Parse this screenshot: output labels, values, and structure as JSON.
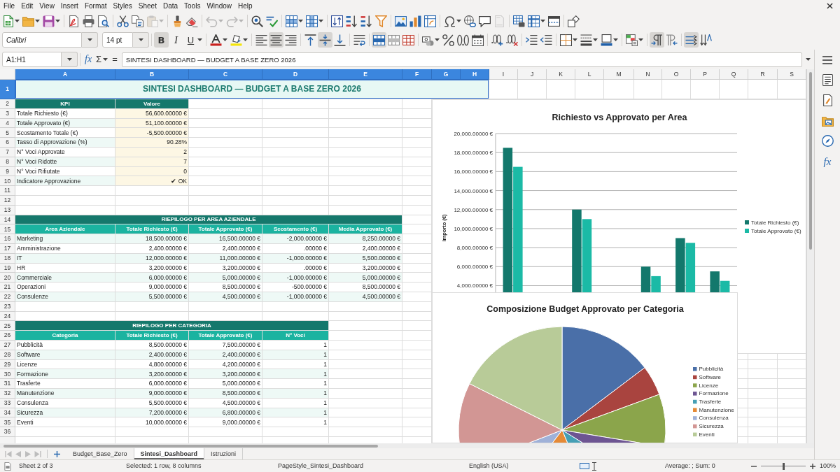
{
  "menu": [
    "File",
    "Edit",
    "View",
    "Insert",
    "Format",
    "Styles",
    "Sheet",
    "Data",
    "Tools",
    "Window",
    "Help"
  ],
  "standard_toolbar": [
    [
      {
        "kind": "new",
        "disabled": false
      },
      {
        "kind": "open",
        "disabled": false
      },
      {
        "kind": "save",
        "disabled": false
      }
    ],
    [
      {
        "kind": "pdf",
        "disabled": false
      },
      {
        "kind": "print",
        "disabled": false
      },
      {
        "kind": "preview",
        "disabled": false
      }
    ],
    [
      {
        "kind": "cut",
        "disabled": false
      },
      {
        "kind": "copy",
        "disabled": false
      },
      {
        "kind": "paste",
        "disabled": true
      }
    ],
    [
      {
        "kind": "clone",
        "disabled": false
      },
      {
        "kind": "clear",
        "disabled": false
      }
    ],
    [
      {
        "kind": "undo",
        "disabled": true
      },
      {
        "kind": "redo",
        "disabled": true
      }
    ],
    [
      {
        "kind": "find",
        "disabled": false
      },
      {
        "kind": "spelling",
        "disabled": false
      }
    ],
    [
      {
        "kind": "row",
        "disabled": false
      },
      {
        "kind": "column",
        "disabled": false
      }
    ],
    [
      {
        "kind": "sort",
        "disabled": false
      },
      {
        "kind": "ascending",
        "disabled": false
      },
      {
        "kind": "descending",
        "disabled": false
      },
      {
        "kind": "filter",
        "disabled": false
      }
    ],
    [
      {
        "kind": "image",
        "disabled": false
      },
      {
        "kind": "chart",
        "disabled": false
      },
      {
        "kind": "pivot",
        "disabled": false
      }
    ],
    [
      {
        "kind": "symbol",
        "disabled": false
      },
      {
        "kind": "hyperlink",
        "disabled": false
      },
      {
        "kind": "comment",
        "disabled": false
      },
      {
        "kind": "headerfooter",
        "disabled": true
      }
    ],
    [
      {
        "kind": "printarea",
        "disabled": false
      },
      {
        "kind": "freeze",
        "disabled": false
      },
      {
        "kind": "split",
        "disabled": false
      }
    ],
    [
      {
        "kind": "shapes",
        "disabled": false
      }
    ]
  ],
  "formatting_toolbar": {
    "font_name": "Calibri",
    "font_size": "14 pt",
    "groups": [
      [
        {
          "kind": "bold",
          "label": "B",
          "on": true
        },
        {
          "kind": "italic",
          "label": "I",
          "on": false
        },
        {
          "kind": "underline",
          "label": "U",
          "on": false
        }
      ],
      [
        {
          "kind": "fontcolor",
          "on": false
        },
        {
          "kind": "highlight",
          "on": false
        }
      ],
      [
        {
          "kind": "alignleft",
          "on": false
        },
        {
          "kind": "aligncenter",
          "on": true
        },
        {
          "kind": "alignright",
          "on": false
        }
      ],
      [
        {
          "kind": "aligntop",
          "on": false
        },
        {
          "kind": "alignmiddle",
          "on": true
        },
        {
          "kind": "alignbottom",
          "on": false
        }
      ],
      [
        {
          "kind": "wrap",
          "on": false
        }
      ],
      [
        {
          "kind": "mergecenter",
          "on": true
        },
        {
          "kind": "merge",
          "on": false
        },
        {
          "kind": "unmerge",
          "on": false
        }
      ],
      [
        {
          "kind": "currency",
          "on": false
        },
        {
          "kind": "percent",
          "on": false
        },
        {
          "kind": "number",
          "on": false
        },
        {
          "kind": "date",
          "on": false
        }
      ],
      [
        {
          "kind": "adddecimal",
          "on": false
        },
        {
          "kind": "deletedecimal",
          "on": false
        }
      ],
      [
        {
          "kind": "indent",
          "on": false
        },
        {
          "kind": "outdent",
          "on": false
        }
      ],
      [
        {
          "kind": "borders",
          "on": false
        },
        {
          "kind": "borderstyle",
          "on": false
        },
        {
          "kind": "bordercolor",
          "on": false
        }
      ],
      [
        {
          "kind": "conditional",
          "on": false
        }
      ],
      [
        {
          "kind": "ltr",
          "on": true
        },
        {
          "kind": "rtl",
          "on": false
        }
      ],
      [
        {
          "kind": "horizontal",
          "on": true
        },
        {
          "kind": "vertical",
          "on": false
        }
      ]
    ]
  },
  "formula_bar": {
    "name_box": "A1:H1",
    "wizard": "fx",
    "sum": "Σ",
    "equals": "=",
    "formula": "SINTESI DASHBOARD — BUDGET A BASE ZERO 2026"
  },
  "sidebar": {
    "functions_tab": "fx"
  },
  "sheet": {
    "columns": [
      {
        "label": "A",
        "selected": true
      },
      {
        "label": "B",
        "selected": true
      },
      {
        "label": "C",
        "selected": true
      },
      {
        "label": "D",
        "selected": true
      },
      {
        "label": "E",
        "selected": true
      },
      {
        "label": "F",
        "selected": true
      },
      {
        "label": "G",
        "selected": true
      },
      {
        "label": "H",
        "selected": true
      },
      {
        "label": "I",
        "selected": false
      },
      {
        "label": "J",
        "selected": false
      },
      {
        "label": "K",
        "selected": false
      },
      {
        "label": "L",
        "selected": false
      },
      {
        "label": "M",
        "selected": false
      },
      {
        "label": "N",
        "selected": false
      },
      {
        "label": "O",
        "selected": false
      },
      {
        "label": "P",
        "selected": false
      },
      {
        "label": "Q",
        "selected": false
      },
      {
        "label": "R",
        "selected": false
      },
      {
        "label": "S",
        "selected": false
      }
    ],
    "rows": [
      {
        "label": "1",
        "selected": true
      },
      {
        "label": "2",
        "selected": false
      },
      {
        "label": "3",
        "selected": false
      },
      {
        "label": "4",
        "selected": false
      },
      {
        "label": "5",
        "selected": false
      },
      {
        "label": "6",
        "selected": false
      },
      {
        "label": "7",
        "selected": false
      },
      {
        "label": "8",
        "selected": false
      },
      {
        "label": "9",
        "selected": false
      },
      {
        "label": "10",
        "selected": false
      },
      {
        "label": "11",
        "selected": false
      },
      {
        "label": "12",
        "selected": false
      },
      {
        "label": "13",
        "selected": false
      },
      {
        "label": "14",
        "selected": false
      },
      {
        "label": "15",
        "selected": false
      },
      {
        "label": "16",
        "selected": false
      },
      {
        "label": "17",
        "selected": false
      },
      {
        "label": "18",
        "selected": false
      },
      {
        "label": "19",
        "selected": false
      },
      {
        "label": "20",
        "selected": false
      },
      {
        "label": "21",
        "selected": false
      },
      {
        "label": "22",
        "selected": false
      },
      {
        "label": "23",
        "selected": false
      },
      {
        "label": "24",
        "selected": false
      },
      {
        "label": "25",
        "selected": false
      },
      {
        "label": "26",
        "selected": false
      },
      {
        "label": "27",
        "selected": false
      },
      {
        "label": "28",
        "selected": false
      },
      {
        "label": "29",
        "selected": false
      },
      {
        "label": "30",
        "selected": false
      },
      {
        "label": "31",
        "selected": false
      },
      {
        "label": "32",
        "selected": false
      },
      {
        "label": "33",
        "selected": false
      },
      {
        "label": "34",
        "selected": false
      },
      {
        "label": "35",
        "selected": false
      },
      {
        "label": "36",
        "selected": false
      }
    ],
    "title": "SINTESI DASHBOARD — BUDGET A BASE ZERO 2026",
    "kpi_table": {
      "columns": [
        "KPI",
        "Valore"
      ],
      "rows": [
        [
          "Totale Richiesto (€)",
          "56,600.00000 €"
        ],
        [
          "Totale Approvato (€)",
          "51,100.00000 €"
        ],
        [
          "Scostamento Totale (€)",
          "-5,500.00000 €"
        ],
        [
          "Tasso di Approvazione (%)",
          "90.28%"
        ],
        [
          "N° Voci Approvate",
          "2"
        ],
        [
          "N° Voci Ridotte",
          "7"
        ],
        [
          "N° Voci Rifiutate",
          "0"
        ],
        [
          "Indicatore Approvazione",
          "✔ OK"
        ]
      ]
    },
    "area_table": {
      "title": "RIEPILOGO PER AREA AZIENDALE",
      "columns": [
        "Area Aziendale",
        "Totale Richiesto (€)",
        "Totale Approvato (€)",
        "Scostamento (€)",
        "Media Approvato (€)"
      ],
      "rows": [
        [
          "Marketing",
          "18,500.00000 €",
          "16,500.00000 €",
          "-2,000.00000 €",
          "8,250.00000 €"
        ],
        [
          "Amministrazione",
          "2,400.00000 €",
          "2,400.00000 €",
          ".00000 €",
          "2,400.00000 €"
        ],
        [
          "IT",
          "12,000.00000 €",
          "11,000.00000 €",
          "-1,000.00000 €",
          "5,500.00000 €"
        ],
        [
          "HR",
          "3,200.00000 €",
          "3,200.00000 €",
          ".00000 €",
          "3,200.00000 €"
        ],
        [
          "Commerciale",
          "6,000.00000 €",
          "5,000.00000 €",
          "-1,000.00000 €",
          "5,000.00000 €"
        ],
        [
          "Operazioni",
          "9,000.00000 €",
          "8,500.00000 €",
          "-500.00000 €",
          "8,500.00000 €"
        ],
        [
          "Consulenze",
          "5,500.00000 €",
          "4,500.00000 €",
          "-1,000.00000 €",
          "4,500.00000 €"
        ]
      ]
    },
    "category_table": {
      "title": "RIEPILOGO PER CATEGORIA",
      "columns": [
        "Categoria",
        "Totale Richiesto (€)",
        "Totale Approvato (€)",
        "N° Voci"
      ],
      "rows": [
        [
          "Pubblicità",
          "8,500.00000 €",
          "7,500.00000 €",
          "1"
        ],
        [
          "Software",
          "2,400.00000 €",
          "2,400.00000 €",
          "1"
        ],
        [
          "Licenze",
          "4,800.00000 €",
          "4,200.00000 €",
          "1"
        ],
        [
          "Formazione",
          "3,200.00000 €",
          "3,200.00000 €",
          "1"
        ],
        [
          "Trasferte",
          "6,000.00000 €",
          "5,000.00000 €",
          "1"
        ],
        [
          "Manutenzione",
          "9,000.00000 €",
          "8,500.00000 €",
          "1"
        ],
        [
          "Consulenza",
          "5,500.00000 €",
          "4,500.00000 €",
          "1"
        ],
        [
          "Sicurezza",
          "7,200.00000 €",
          "6,800.00000 €",
          "1"
        ],
        [
          "Eventi",
          "10,000.00000 €",
          "9,000.00000 €",
          "1"
        ]
      ]
    }
  },
  "bar_chart": {
    "chart_data": {
      "type": "bar",
      "title": "Richiesto vs Approvato per Area",
      "ylabel": "Importo (€)",
      "stacked": false,
      "grid": true,
      "legend": "right",
      "series": [
        {
          "name": "Totale Richiesto (€)",
          "color": "#13786c",
          "values": [
            18500,
            null,
            12000,
            null,
            6000,
            9000,
            5500
          ]
        },
        {
          "name": "Totale Approvato (€)",
          "color": "#1bbaa6",
          "values": [
            16500,
            null,
            11000,
            null,
            5000,
            8500,
            4500
          ]
        }
      ],
      "ylim": [
        3300,
        20000
      ],
      "yticks": [
        {
          "value": 4000,
          "label": "4,000.00000 €"
        },
        {
          "value": 6000,
          "label": "6,000.00000 €"
        },
        {
          "value": 8000,
          "label": "8,000.00000 €"
        },
        {
          "value": 10000,
          "label": "10,000.00000 €"
        },
        {
          "value": 12000,
          "label": "12,000.00000 €"
        },
        {
          "value": 14000,
          "label": "14,000.00000 €"
        },
        {
          "value": 16000,
          "label": "16,000.00000 €"
        },
        {
          "value": 18000,
          "label": "18,000.00000 €"
        },
        {
          "value": 20000,
          "label": "20,000.00000 €"
        }
      ]
    }
  },
  "pie_chart": {
    "chart_data": {
      "type": "pie",
      "title": "Composizione Budget Approvato per Categoria",
      "legend": "right",
      "categories": [
        "Pubblicità",
        "Software",
        "Licenze",
        "Formazione",
        "Trasferte",
        "Manutenzione",
        "Consulenza",
        "Sicurezza",
        "Eventi"
      ],
      "values": [
        14.7,
        4.7,
        8.2,
        6.3,
        9.8,
        16.6,
        8.8,
        13.3,
        17.6
      ]
    }
  },
  "sheet_tabs": {
    "navigation_disabled": true,
    "tabs": [
      {
        "label": "Budget_Base_Zero",
        "selected": false
      },
      {
        "label": "Sintesi_Dashboard",
        "selected": true
      },
      {
        "label": "Istruzioni",
        "selected": false
      }
    ]
  },
  "status_bar": {
    "sheet": "Sheet 2 of 3",
    "selection": "Selected: 1 row, 8 columns",
    "page_style": "PageStyle_Sintesi_Dashboard",
    "language": "English (USA)",
    "summary": "Average: ; Sum: 0",
    "zoom": {
      "level": 0.5,
      "reading": "100%"
    }
  }
}
